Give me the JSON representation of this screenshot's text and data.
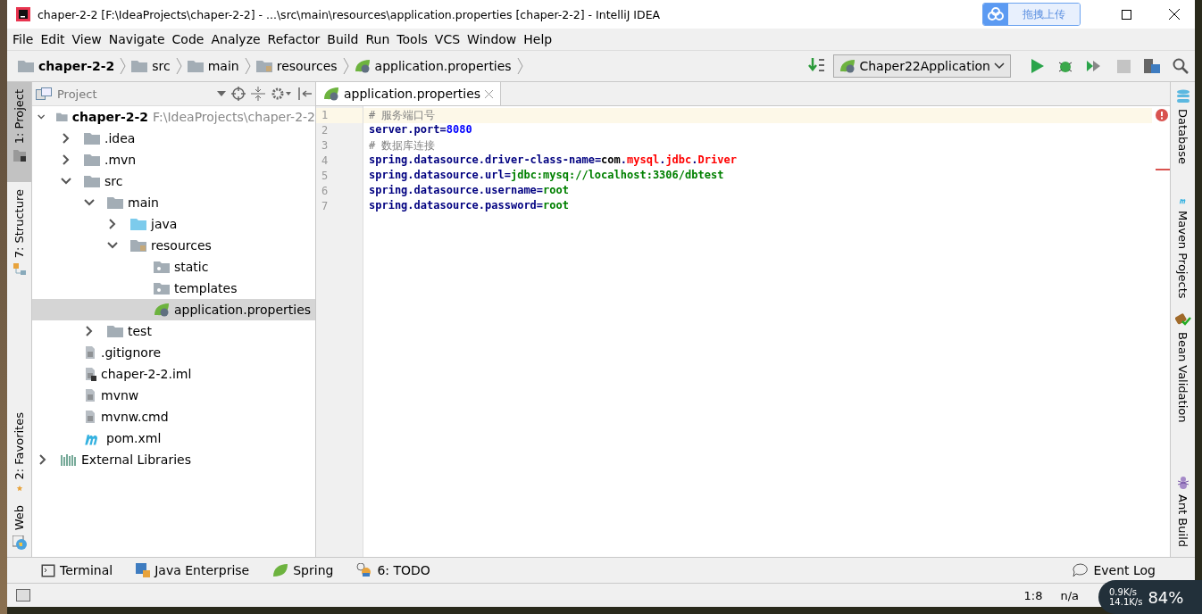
{
  "window": {
    "title": "chaper-2-2 [F:\\IdeaProjects\\chaper-2-2] - ...\\src\\main\\resources\\application.properties [chaper-2-2] - IntelliJ IDEA",
    "upload_button": "拖拽上传"
  },
  "menu": [
    "File",
    "Edit",
    "View",
    "Navigate",
    "Code",
    "Analyze",
    "Refactor",
    "Build",
    "Run",
    "Tools",
    "VCS",
    "Window",
    "Help"
  ],
  "breadcrumbs": [
    {
      "label": "chaper-2-2",
      "kind": "project"
    },
    {
      "label": "src",
      "kind": "folder"
    },
    {
      "label": "main",
      "kind": "folder"
    },
    {
      "label": "resources",
      "kind": "resources"
    },
    {
      "label": "application.properties",
      "kind": "spring"
    }
  ],
  "run_config": "Chaper22Application",
  "left_tools": [
    {
      "label": "1: Project",
      "selected": true,
      "kind": "project"
    },
    {
      "label": "7: Structure",
      "selected": false,
      "kind": "structure"
    },
    {
      "label": "2: Favorites",
      "selected": false,
      "kind": "favorites"
    },
    {
      "label": "Web",
      "selected": false,
      "kind": "web"
    }
  ],
  "project_panel": {
    "title": "Project"
  },
  "tree": [
    {
      "label": "chaper-2-2",
      "path": "F:\\IdeaProjects\\chaper-2-2",
      "kind": "project",
      "expanded": true,
      "selected": false,
      "children": [
        {
          "label": ".idea",
          "kind": "folder",
          "expanded": false,
          "selected": false
        },
        {
          "label": ".mvn",
          "kind": "folder",
          "expanded": false,
          "selected": false
        },
        {
          "label": "src",
          "kind": "folder",
          "expanded": true,
          "selected": false,
          "children": [
            {
              "label": "main",
              "kind": "folder",
              "expanded": true,
              "selected": false,
              "children": [
                {
                  "label": "java",
                  "kind": "source",
                  "expanded": false,
                  "selected": false
                },
                {
                  "label": "resources",
                  "kind": "resources",
                  "expanded": true,
                  "selected": false,
                  "children": [
                    {
                      "label": "static",
                      "kind": "web-folder",
                      "selected": false
                    },
                    {
                      "label": "templates",
                      "kind": "web-folder",
                      "selected": false
                    },
                    {
                      "label": "application.properties",
                      "kind": "spring",
                      "selected": true
                    }
                  ]
                }
              ]
            },
            {
              "label": "test",
              "kind": "folder",
              "expanded": false,
              "selected": false
            }
          ]
        },
        {
          "label": ".gitignore",
          "kind": "file",
          "selected": false
        },
        {
          "label": "chaper-2-2.iml",
          "kind": "iml",
          "selected": false
        },
        {
          "label": "mvnw",
          "kind": "file",
          "selected": false
        },
        {
          "label": "mvnw.cmd",
          "kind": "file",
          "selected": false
        },
        {
          "label": "pom.xml",
          "kind": "maven",
          "selected": false
        }
      ]
    },
    {
      "label": "External Libraries",
      "kind": "libraries",
      "expanded": false,
      "selected": false
    }
  ],
  "editor_tabs": [
    {
      "label": "application.properties",
      "selected": true
    }
  ],
  "code": [
    {
      "number": "1",
      "current": true,
      "tokens": [
        {
          "text": "# 服务端口号",
          "kind": "comment"
        }
      ]
    },
    {
      "number": "2",
      "current": false,
      "tokens": [
        {
          "text": "server.port",
          "kind": "key"
        },
        {
          "text": "=",
          "kind": "sep"
        },
        {
          "text": "8080",
          "kind": "number"
        }
      ]
    },
    {
      "number": "3",
      "current": false,
      "tokens": [
        {
          "text": "# 数据库连接",
          "kind": "comment"
        }
      ]
    },
    {
      "number": "4",
      "current": false,
      "tokens": [
        {
          "text": "spring.datasource.driver-class-name",
          "kind": "key"
        },
        {
          "text": "=",
          "kind": "sep"
        },
        {
          "text": "com",
          "kind": "plain"
        },
        {
          "text": ".",
          "kind": "sep"
        },
        {
          "text": "mysql",
          "kind": "error"
        },
        {
          "text": ".",
          "kind": "sep"
        },
        {
          "text": "jdbc",
          "kind": "error"
        },
        {
          "text": ".",
          "kind": "sep"
        },
        {
          "text": "Driver",
          "kind": "error"
        }
      ]
    },
    {
      "number": "5",
      "current": false,
      "tokens": [
        {
          "text": "spring.datasource.url",
          "kind": "key"
        },
        {
          "text": "=",
          "kind": "sep"
        },
        {
          "text": "jdbc:mysq://localhost:3306/dbtest",
          "kind": "value"
        }
      ]
    },
    {
      "number": "6",
      "current": false,
      "tokens": [
        {
          "text": "spring.datasource.username",
          "kind": "key"
        },
        {
          "text": "=",
          "kind": "sep"
        },
        {
          "text": "root",
          "kind": "value"
        }
      ]
    },
    {
      "number": "7",
      "current": false,
      "tokens": [
        {
          "text": "spring.datasource.password",
          "kind": "key"
        },
        {
          "text": "=",
          "kind": "sep"
        },
        {
          "text": "root",
          "kind": "value"
        }
      ]
    }
  ],
  "right_tools": [
    {
      "label": "Database",
      "kind": "database"
    },
    {
      "label": "Maven Projects",
      "kind": "maven"
    },
    {
      "label": "Bean Validation",
      "kind": "bean"
    },
    {
      "label": "Ant Build",
      "kind": "ant"
    }
  ],
  "bottom_tools": [
    {
      "label": "Terminal",
      "kind": "terminal"
    },
    {
      "label": "Java Enterprise",
      "kind": "enterprise"
    },
    {
      "label": "Spring",
      "kind": "spring"
    },
    {
      "label": "6: TODO",
      "kind": "todo"
    }
  ],
  "event_log": "Event Log",
  "status_bar": {
    "position": "1:8",
    "encoding": "n/a"
  },
  "net_widget": {
    "upload": "0.9K/s",
    "download": "14.1K/s",
    "percent": "84%"
  }
}
